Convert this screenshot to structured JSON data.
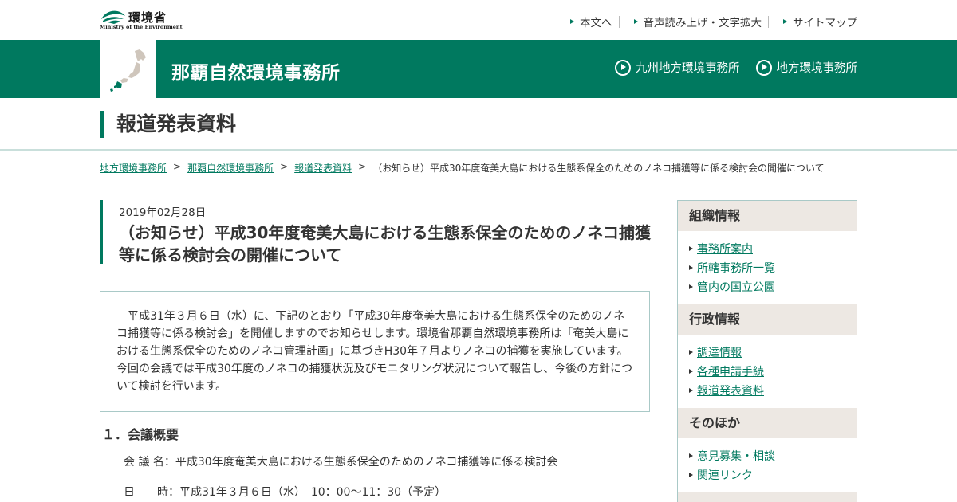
{
  "header": {
    "logo_text": "環境省",
    "logo_sub": "Ministry of the Environment",
    "top_links": [
      "本文へ",
      "音声読み上げ・文字拡大",
      "サイトマップ"
    ]
  },
  "office": {
    "title": "那覇自然環境事務所",
    "region_links": [
      "九州地方環境事務所",
      "地方環境事務所"
    ]
  },
  "section": {
    "title": "報道発表資料"
  },
  "breadcrumb": {
    "links": [
      "地方環境事務所",
      "那覇自然環境事務所",
      "報道発表資料"
    ],
    "separator": ">",
    "current": "（お知らせ）平成30年度奄美大島における生態系保全のためのノネコ捕獲等に係る検討会の開催について"
  },
  "article": {
    "date": "2019年02月28日",
    "title": "（お知らせ）平成30年度奄美大島における生態系保全のためのノネコ捕獲等に係る検討会の開催について",
    "summary": "平成31年３月６日（水）に、下記のとおり「平成30年度奄美大島における生態系保全のためのノネコ捕獲等に係る検討会」を開催しますのでお知らせします。環境省那覇自然環境事務所は「奄美大島における生態系保全のためのノネコ管理計画」に基づきH30年７月よりノネコの捕獲を実施しています。今回の会議では平成30年度のノネコの捕獲状況及びモニタリング状況について報告し、今後の方針について検討を行います。",
    "section1_heading": "１．会議概要",
    "meeting_name": "会 議 名：平成30年度奄美大島における生態系保全のためのノネコ捕獲等に係る検討会",
    "meeting_time": "日　　時：平成31年３月６日（水）　10：00～11：30（予定）"
  },
  "sidebar": {
    "sections": [
      {
        "heading": "組織情報",
        "items": [
          "事務所案内",
          "所轄事務所一覧",
          "管内の国立公園"
        ]
      },
      {
        "heading": "行政情報",
        "items": [
          "調達情報",
          "各種申請手続",
          "報道発表資料"
        ]
      },
      {
        "heading": "そのほか",
        "items": [
          "意見募集・相談",
          "関連リンク"
        ]
      }
    ]
  },
  "colors": {
    "brand_green": "#00795f",
    "sidebar_head_bg": "#ede8e3",
    "border": "#a9c9c7"
  }
}
